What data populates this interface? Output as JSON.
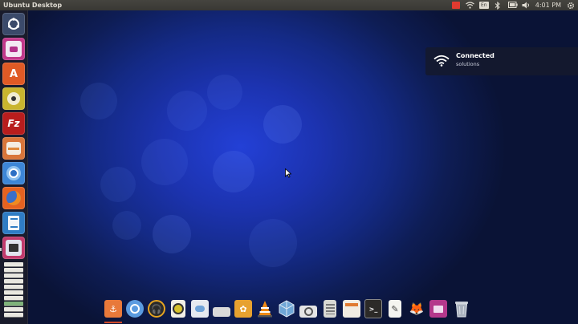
{
  "panel": {
    "title": "Ubuntu Desktop",
    "keyboard": "En",
    "time": "4:01 PM"
  },
  "notification": {
    "title": "Connected",
    "subtitle": "solutions"
  },
  "launcher_items": [
    "dash-home-icon",
    "video-player-icon",
    "software-center-icon",
    "amarok-icon",
    "filezilla-icon",
    "files-icon",
    "chromium-icon",
    "firefox-icon",
    "libreoffice-writer-icon",
    "media-icon"
  ],
  "dock_items": [
    "anchor-icon",
    "chromium-icon",
    "headphones-icon",
    "music-player-icon",
    "messaging-icon",
    "drive-icon",
    "photos-icon",
    "vlc-icon",
    "virtualbox-icon",
    "screenshot-icon",
    "calculator-icon",
    "files-icon",
    "terminal-icon",
    "text-editor-icon",
    "gimp-icon",
    "video-icon",
    "trash-icon"
  ]
}
